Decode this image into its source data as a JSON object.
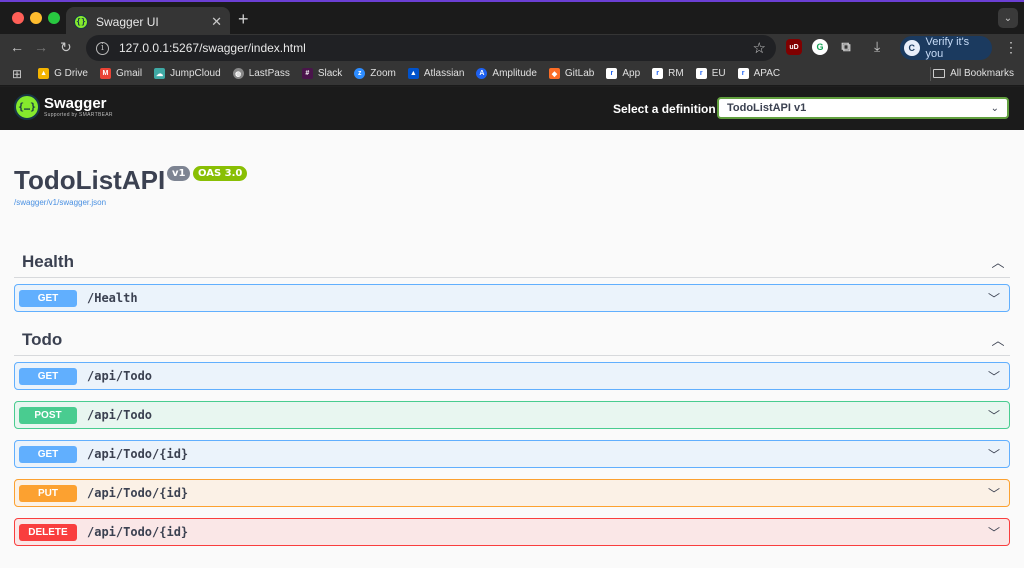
{
  "browser": {
    "tab_title": "Swagger UI",
    "url": "127.0.0.1:5267/swagger/index.html",
    "verify_label": "Verify it's you",
    "bookmarks": [
      "G Drive",
      "Gmail",
      "JumpCloud",
      "LastPass",
      "Slack",
      "Zoom",
      "Atlassian",
      "Amplitude",
      "GitLab",
      "App",
      "RM",
      "EU",
      "APAC"
    ],
    "all_bookmarks": "All Bookmarks"
  },
  "swagger": {
    "logo_title": "Swagger",
    "logo_sub": "Supported by SMARTBEAR",
    "definition_label": "Select a definition",
    "definition_value": "TodoListAPI v1",
    "api_title": "TodoListAPI",
    "version": "v1",
    "oas": "OAS 3.0",
    "spec_url": "/swagger/v1/swagger.json",
    "tags": [
      {
        "name": "Health",
        "operations": [
          {
            "method": "GET",
            "path": "/Health"
          }
        ]
      },
      {
        "name": "Todo",
        "operations": [
          {
            "method": "GET",
            "path": "/api/Todo"
          },
          {
            "method": "POST",
            "path": "/api/Todo"
          },
          {
            "method": "GET",
            "path": "/api/Todo/{id}"
          },
          {
            "method": "PUT",
            "path": "/api/Todo/{id}"
          },
          {
            "method": "DELETE",
            "path": "/api/Todo/{id}"
          }
        ]
      }
    ]
  },
  "colors": {
    "get": "#61affe",
    "post": "#49cc90",
    "put": "#fca130",
    "delete": "#f93e3e",
    "swagger_green": "#85ea2d"
  }
}
